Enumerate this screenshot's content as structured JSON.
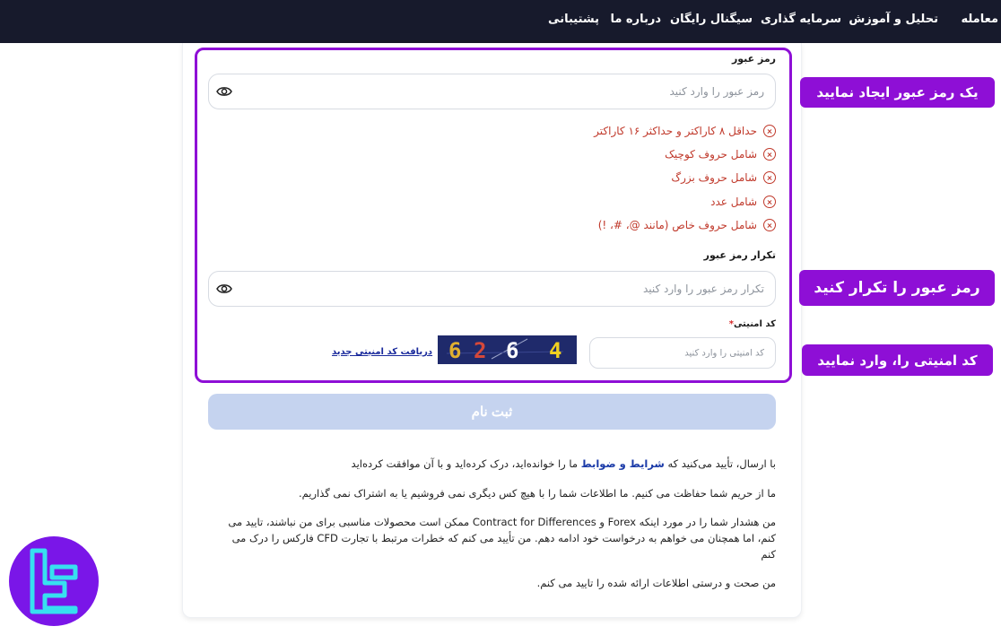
{
  "nav": {
    "items": [
      "معامله",
      "تحلیل و آموزش",
      "سرمایه گذاری",
      "سیگنال رایگان",
      "درباره ما",
      "پشتیبانی"
    ]
  },
  "form": {
    "password_label": "رمز عبور",
    "password_placeholder": "رمز عبور را وارد کنید",
    "rules": [
      "حداقل ۸ کاراکتر و حداکثر ۱۶ کاراکتر",
      "شامل حروف کوچیک",
      "شامل حروف بزرگ",
      "شامل عدد",
      "شامل حروف خاص (مانند @، #، !)"
    ],
    "confirm_label": "تکرار رمز عبور",
    "confirm_placeholder": "تکرار رمز عبور را وارد کنید",
    "captcha_label": "کد امنیتی",
    "captcha_required_mark": "*",
    "captcha_placeholder": "کد امنیتی را وارد کنید",
    "captcha_digits": [
      "6",
      "2",
      "6",
      "4"
    ],
    "new_code_link": "دریافت کد امنیتی جدید",
    "submit_label": "ثبت نام"
  },
  "terms": {
    "line1_prefix": "با ارسال، تأیید می‌کنید که ",
    "line1_link": "شرایط و ضوابط",
    "line1_suffix": " ما را خوانده‌اید، درک کرده‌اید و با آن موافقت کرده‌اید",
    "line2": "ما از حریم شما حفاظت می کنیم. ما اطلاعات شما را با هیچ کس دیگری نمی فروشیم یا به اشتراک نمی گذاریم.",
    "line3": "من هشدار شما را در مورد اینکه Forex و Contract for Differences ممکن است محصولات مناسبی برای من نباشند، تایید می کنم، اما همچنان می خواهم به درخواست خود ادامه دهم. من تأیید می کنم که خطرات مرتبط با تجارت CFD فارکس را درک می کنم",
    "line4": "من صحت و درستی اطلاعات ارائه شده را تایید می کنم."
  },
  "callouts": {
    "create_password": "یک رمز عبور ایجاد نمایید",
    "repeat_password": "رمز عبور را تکرار کنید",
    "enter_captcha": "کد امنیتی را، وارد نمایید"
  },
  "colors": {
    "accent": "#8e0fd6",
    "nav_bg": "#171a2c",
    "error": "#c0392b",
    "submit_disabled": "#c5d3ef"
  }
}
